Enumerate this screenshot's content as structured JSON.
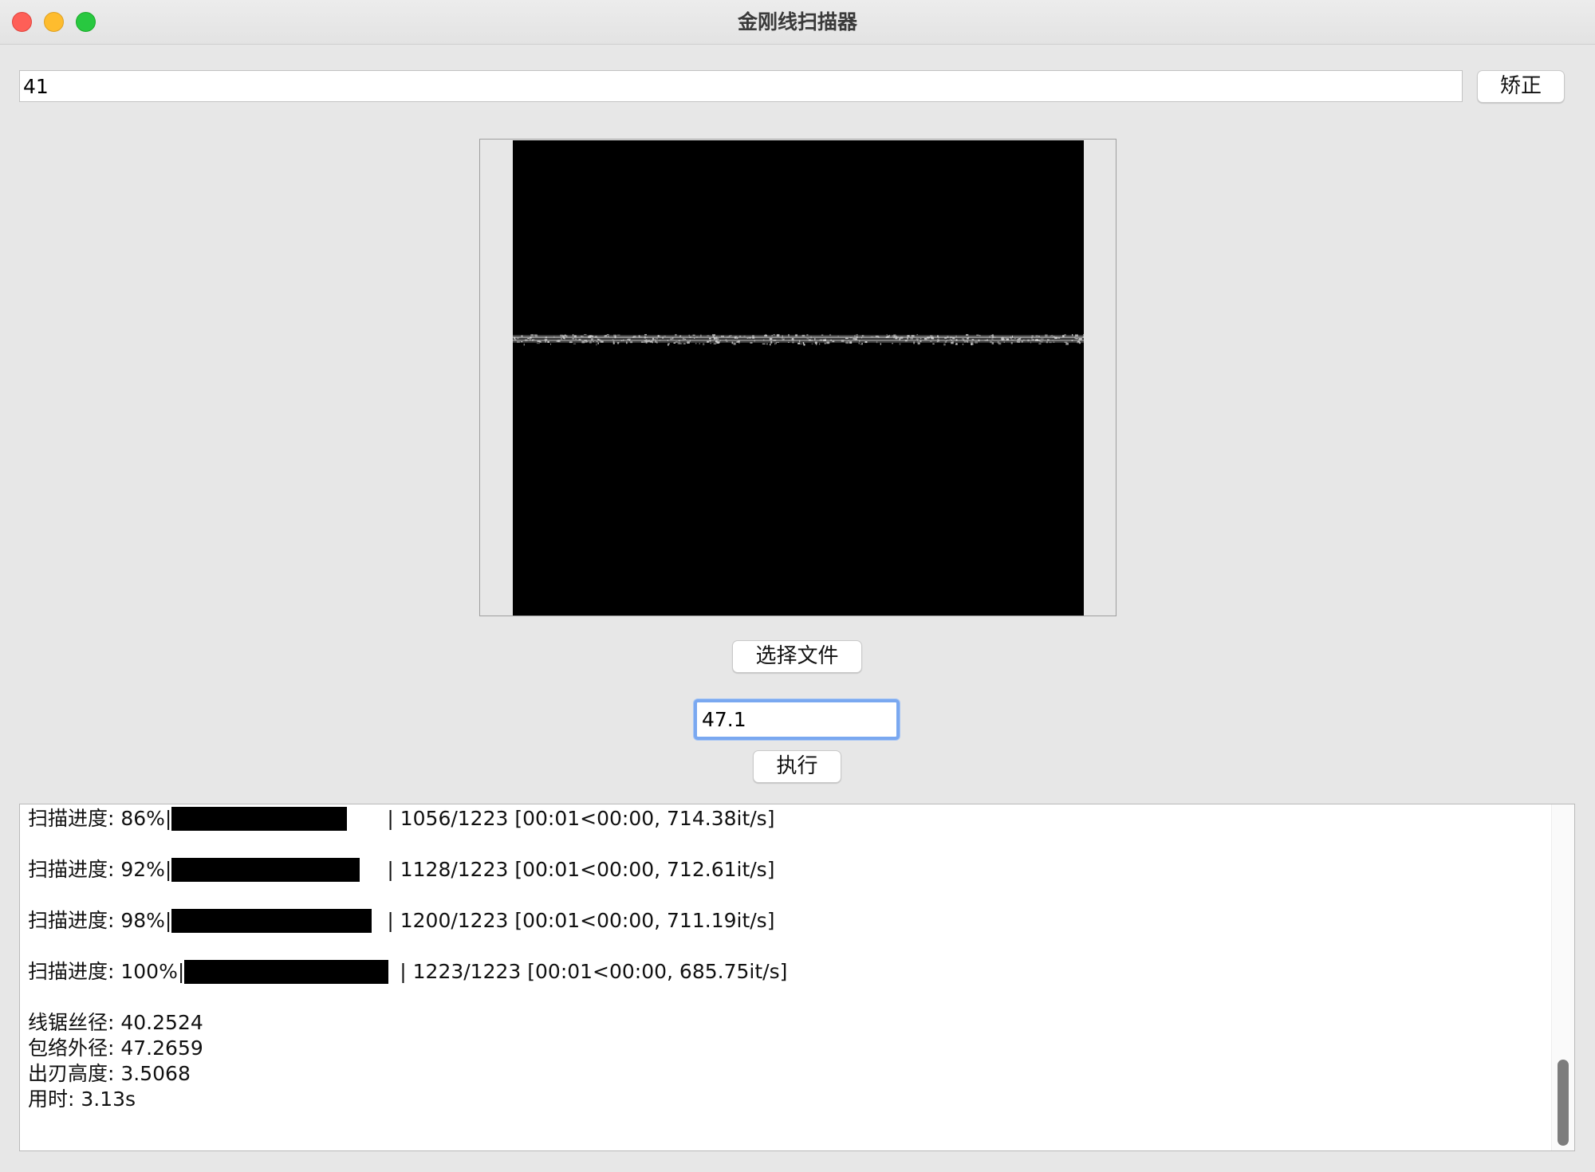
{
  "window": {
    "title": "金刚线扫描器"
  },
  "correction": {
    "input_value": "41",
    "button_label": "矫正"
  },
  "preview": {
    "image_description_icon": "wire-scan-image"
  },
  "controls": {
    "select_file_label": "选择文件",
    "value_input": "47.1",
    "execute_label": "执行"
  },
  "log": {
    "progress": [
      {
        "prefix": "扫描进度:  86%|",
        "percent": 86,
        "suffix": "| 1056/1223 [00:01<00:00, 714.38it/s]"
      },
      {
        "prefix": "扫描进度:  92%|",
        "percent": 92,
        "suffix": "| 1128/1223 [00:01<00:00, 712.61it/s]"
      },
      {
        "prefix": "扫描进度:  98%|",
        "percent": 98,
        "suffix": "| 1200/1223 [00:01<00:00, 711.19it/s]"
      },
      {
        "prefix": "扫描进度: 100%|",
        "percent": 100,
        "suffix": "| 1223/1223 [00:01<00:00, 685.75it/s]"
      }
    ],
    "results": [
      "线锯丝径:  40.2524",
      "包络外径:  47.2659",
      "出刃高度:  3.5068",
      "用时:  3.13s"
    ]
  }
}
